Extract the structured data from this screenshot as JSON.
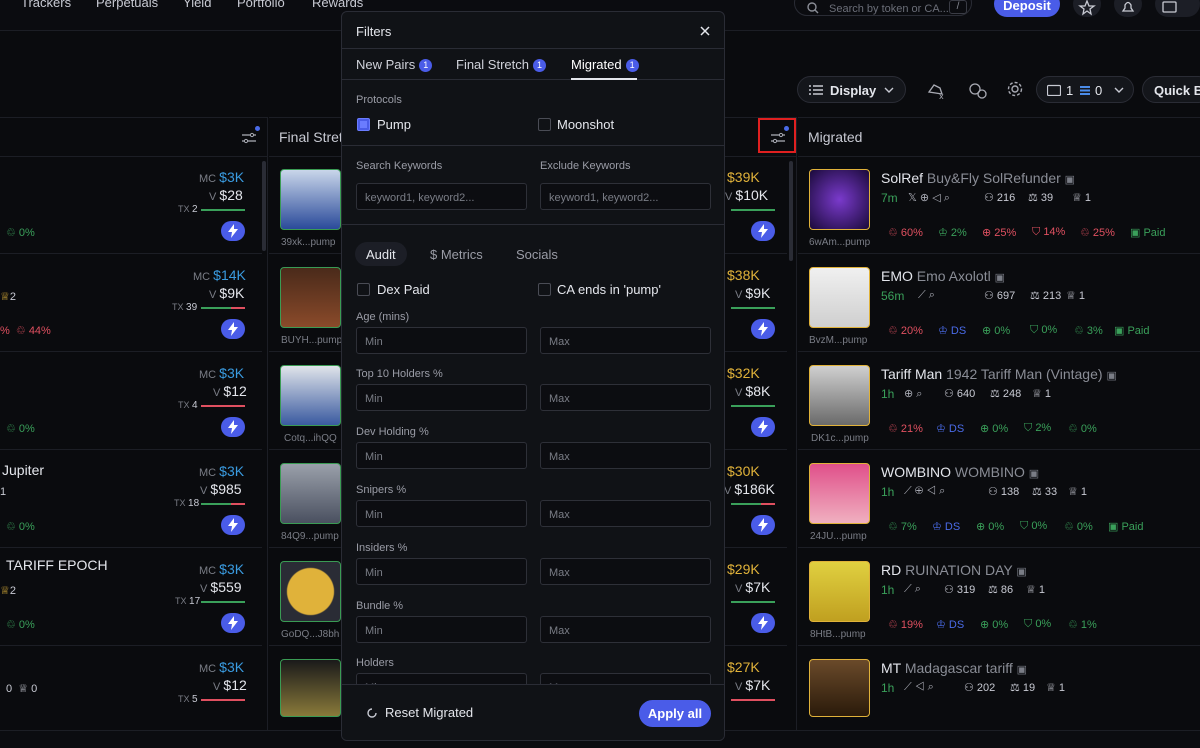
{
  "nav": {
    "items": [
      "Trackers",
      "Perpetuals",
      "Yield",
      "Portfolio",
      "Rewards"
    ]
  },
  "search": {
    "placeholder": "Search by token or CA...",
    "shortcut": "/"
  },
  "deposit_label": "Deposit",
  "toolbar": {
    "display_label": "Display",
    "wallet_count": "1",
    "sol_count": "0",
    "quick_buy": "Quick Bu"
  },
  "columns": {
    "final_stretch": "Final Stret",
    "migrated": "Migrated"
  },
  "left_cards": [
    {
      "mc": "$3K",
      "v": "$28",
      "tx": "2",
      "pct": "0%"
    },
    {
      "mc": "$14K",
      "v": "$9K",
      "tx": "39",
      "n": "2",
      "pct": "44%"
    },
    {
      "mc": "$3K",
      "v": "$12",
      "tx": "4",
      "pct": "0%"
    },
    {
      "name": "Jupiter",
      "mc": "$3K",
      "v": "$985",
      "tx": "18",
      "n": "1",
      "pct": "0%"
    },
    {
      "name": "TARIFF EPOCH",
      "mc": "$3K",
      "v": "$559",
      "tx": "17",
      "n": "2",
      "pct": "0%"
    },
    {
      "mc": "$3K",
      "v": "$12",
      "tx": "5",
      "a": "0",
      "b": "0"
    }
  ],
  "final_cards": [
    {
      "addr": "39xk...pump",
      "mc": "$39K",
      "v": "$10K"
    },
    {
      "addr": "BUYH...pump",
      "mc": "$38K",
      "v": "$9K"
    },
    {
      "addr": "Cotq...ihQQ",
      "mc": "$32K",
      "v": "$8K"
    },
    {
      "addr": "84Q9...pump",
      "mc": "$30K",
      "v": "$186K"
    },
    {
      "addr": "GoDQ...J8bh",
      "mc": "$29K",
      "v": "$7K"
    },
    {
      "addr": "",
      "mc": "$27K",
      "v": "$7K"
    }
  ],
  "migrated_cards": [
    {
      "ticker": "SolRef",
      "name": "Buy&Fly SolRefunder",
      "age": "7m",
      "holders": "216",
      "h2": "39",
      "h3": "1",
      "addr": "6wAm...pump",
      "s1": "60%",
      "s2": "2%",
      "s3": "25%",
      "s4": "14%",
      "s5": "25%",
      "paid": "Paid"
    },
    {
      "ticker": "EMO",
      "name": "Emo Axolotl",
      "age": "56m",
      "holders": "697",
      "h2": "213",
      "h3": "1",
      "addr": "BvzM...pump",
      "s1": "20%",
      "s2": "DS",
      "s3": "0%",
      "s4": "0%",
      "s5": "3%",
      "paid": "Paid"
    },
    {
      "ticker": "Tariff Man",
      "name": "1942 Tariff Man (Vintage)",
      "age": "1h",
      "holders": "640",
      "h2": "248",
      "h3": "1",
      "addr": "DK1c...pump",
      "s1": "21%",
      "s2": "DS",
      "s3": "0%",
      "s4": "2%",
      "s5": "0%",
      "paid": ""
    },
    {
      "ticker": "WOMBINO",
      "name": "WOMBINO",
      "age": "1h",
      "holders": "138",
      "h2": "33",
      "h3": "1",
      "addr": "24JU...pump",
      "s1": "7%",
      "s2": "DS",
      "s3": "0%",
      "s4": "0%",
      "s5": "0%",
      "paid": "Paid"
    },
    {
      "ticker": "RD",
      "name": "RUINATION DAY",
      "age": "1h",
      "holders": "319",
      "h2": "86",
      "h3": "1",
      "addr": "8HtB...pump",
      "s1": "19%",
      "s2": "DS",
      "s3": "0%",
      "s4": "0%",
      "s5": "1%",
      "paid": ""
    },
    {
      "ticker": "MT",
      "name": "Madagascar tariff",
      "age": "1h",
      "holders": "202",
      "h2": "19",
      "h3": "1",
      "addr": "",
      "s1": "",
      "s2": "",
      "s3": "",
      "s4": "",
      "s5": "",
      "paid": ""
    }
  ],
  "modal": {
    "title": "Filters",
    "tabs": [
      {
        "label": "New Pairs",
        "badge": "1"
      },
      {
        "label": "Final Stretch",
        "badge": "1"
      },
      {
        "label": "Migrated",
        "badge": "1"
      }
    ],
    "protocols_label": "Protocols",
    "protocols": [
      {
        "label": "Pump",
        "checked": true
      },
      {
        "label": "Moonshot",
        "checked": false
      }
    ],
    "search_kw_label": "Search Keywords",
    "exclude_kw_label": "Exclude Keywords",
    "kw_placeholder": "keyword1, keyword2...",
    "subtabs": [
      "Audit",
      "$ Metrics",
      "Socials"
    ],
    "dex_paid": "Dex Paid",
    "ca_ends": "CA ends in 'pump'",
    "ranges": [
      "Age (mins)",
      "Top 10 Holders %",
      "Dev Holding %",
      "Snipers %",
      "Insiders %",
      "Bundle %",
      "Holders"
    ],
    "min": "Min",
    "max": "Max",
    "reset": "Reset Migrated",
    "apply": "Apply all"
  }
}
